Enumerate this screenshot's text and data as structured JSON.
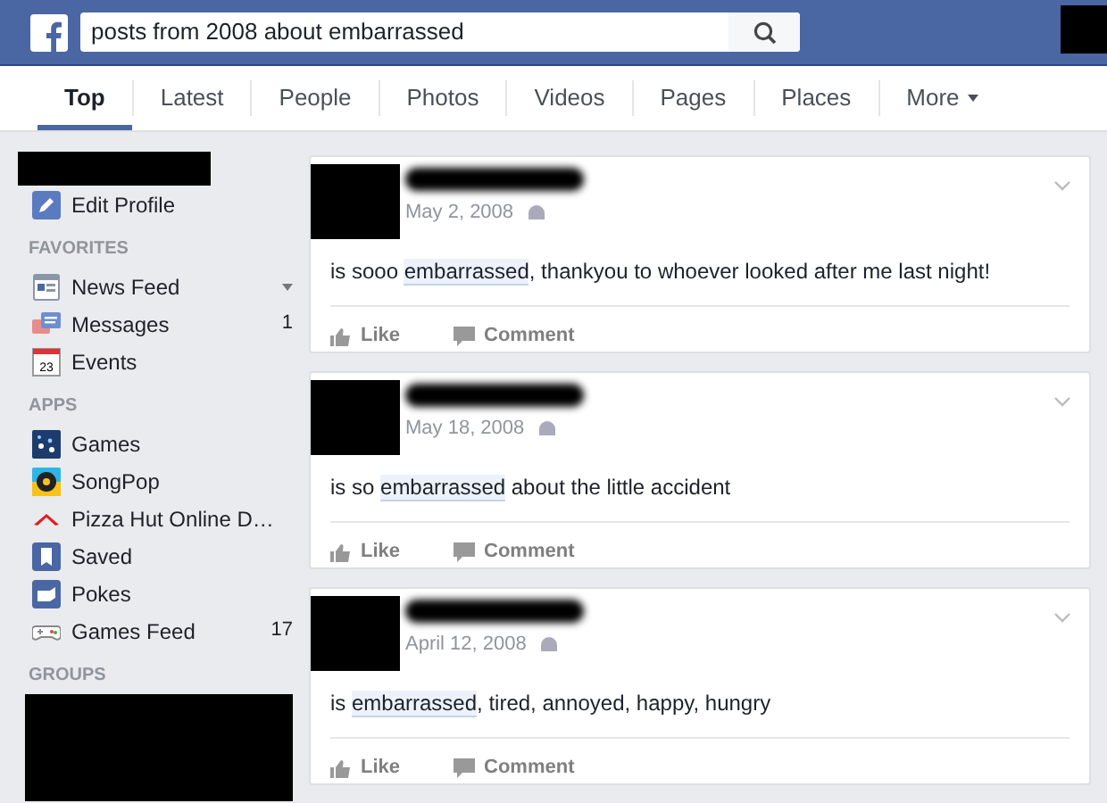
{
  "search": {
    "value": "posts from 2008 about embarrassed"
  },
  "tabs": [
    {
      "label": "Top",
      "selected": true
    },
    {
      "label": "Latest",
      "selected": false
    },
    {
      "label": "People",
      "selected": false
    },
    {
      "label": "Photos",
      "selected": false
    },
    {
      "label": "Videos",
      "selected": false
    },
    {
      "label": "Pages",
      "selected": false
    },
    {
      "label": "Places",
      "selected": false
    },
    {
      "label": "More",
      "selected": false,
      "dropdown": true
    }
  ],
  "sidebar": {
    "profile_link": "Edit Profile",
    "sections": [
      {
        "heading": "FAVORITES",
        "items": [
          {
            "label": "News Feed",
            "dropdown": true
          },
          {
            "label": "Messages",
            "count": "1"
          },
          {
            "label": "Events",
            "icon_text": "23"
          }
        ]
      },
      {
        "heading": "APPS",
        "items": [
          {
            "label": "Games"
          },
          {
            "label": "SongPop"
          },
          {
            "label": "Pizza Hut Online D…"
          },
          {
            "label": "Saved"
          },
          {
            "label": "Pokes"
          },
          {
            "label": "Games Feed",
            "count": "17"
          }
        ]
      },
      {
        "heading": "GROUPS"
      }
    ]
  },
  "posts": [
    {
      "date": "May 2, 2008",
      "text_before": "is sooo ",
      "highlight": "embarrassed",
      "text_after": ", thankyou to whoever looked after me last night!",
      "actions": [
        "Like",
        "Comment"
      ]
    },
    {
      "date": "May 18, 2008",
      "text_before": "is so ",
      "highlight": "embarrassed",
      "text_after": " about the little accident",
      "actions": [
        "Like",
        "Comment"
      ]
    },
    {
      "date": "April 12, 2008",
      "text_before": "is ",
      "highlight": "embarrassed",
      "text_after": ", tired, annoyed, happy, hungry",
      "actions": [
        "Like",
        "Comment"
      ]
    }
  ]
}
